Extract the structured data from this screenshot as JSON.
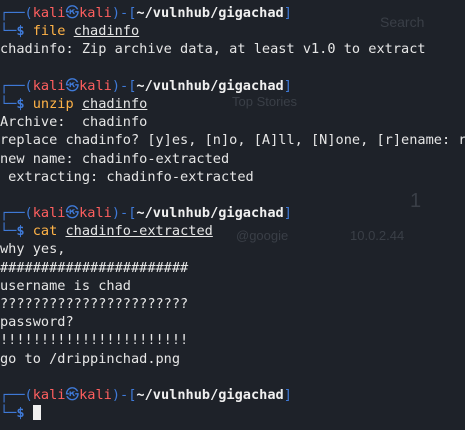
{
  "colors": {
    "background": "#1e2229",
    "prompt_blue": "#3f7ad8",
    "user_red": "#ff5f5f",
    "command_yellow": "#ffb347",
    "text": "#e6e6e6"
  },
  "background_ghost": {
    "search_text": "Search",
    "top_stories": "Top Stories",
    "number": "1",
    "handle": "@googie",
    "version": "10.0.2.44"
  },
  "prompt": {
    "user": "kali",
    "at_symbol": "㉿",
    "host": "kali",
    "path": "~/vulnhub/gigachad",
    "dollar": "$"
  },
  "blocks": [
    {
      "command": "file",
      "argument": "chadinfo",
      "output": [
        "chadinfo: Zip archive data, at least v1.0 to extract"
      ]
    },
    {
      "command": "unzip",
      "argument": "chadinfo",
      "output": [
        "Archive:  chadinfo",
        "replace chadinfo? [y]es, [n]o, [A]ll, [N]one, [r]ename: r",
        "new name: chadinfo-extracted",
        " extracting: chadinfo-extracted"
      ]
    },
    {
      "command": "cat",
      "argument": "chadinfo-extracted",
      "output": [
        "why yes,",
        "#######################",
        "username is chad",
        "???????????????????????",
        "password?",
        "!!!!!!!!!!!!!!!!!!!!!!!",
        "go to /drippinchad.png"
      ]
    }
  ]
}
